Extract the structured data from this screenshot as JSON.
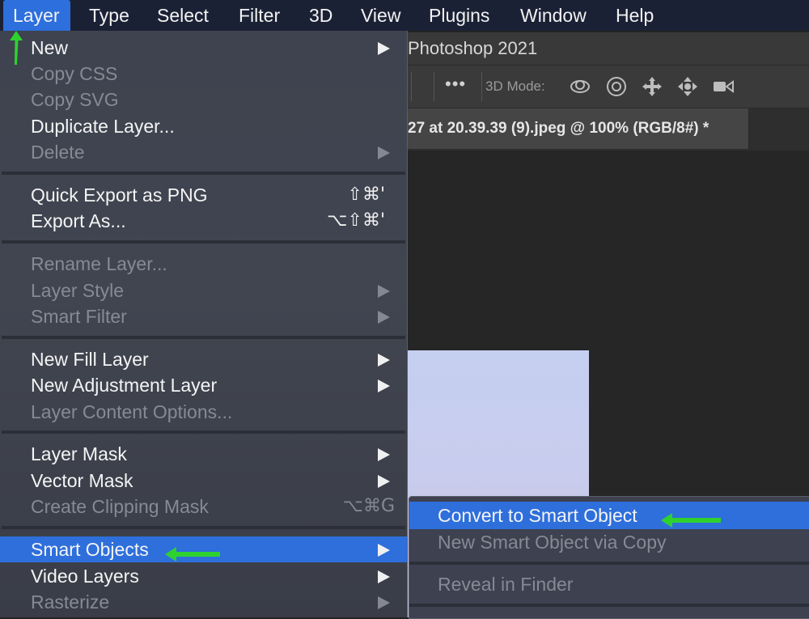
{
  "menubar": {
    "items": [
      "Layer",
      "Type",
      "Select",
      "Filter",
      "3D",
      "View",
      "Plugins",
      "Window",
      "Help"
    ],
    "active": "Layer"
  },
  "window": {
    "title": "Photoshop 2021",
    "options": {
      "more": "•••",
      "mode_label": "3D Mode:"
    },
    "document_tab": "27 at 20.39.39 (9).jpeg @ 100% (RGB/8#) *"
  },
  "menu": {
    "items": [
      {
        "label": "New",
        "submenu": true
      },
      {
        "label": "Copy CSS",
        "disabled": true
      },
      {
        "label": "Copy SVG",
        "disabled": true
      },
      {
        "label": "Duplicate Layer..."
      },
      {
        "label": "Delete",
        "disabled": true,
        "submenu": true
      },
      {
        "label": "Quick Export as PNG",
        "shortcut": "⇧⌘'"
      },
      {
        "label": "Export As...",
        "shortcut": "⌥⇧⌘'"
      },
      {
        "label": "Rename Layer...",
        "disabled": true
      },
      {
        "label": "Layer Style",
        "disabled": true,
        "submenu": true
      },
      {
        "label": "Smart Filter",
        "disabled": true,
        "submenu": true
      },
      {
        "label": "New Fill Layer",
        "submenu": true
      },
      {
        "label": "New Adjustment Layer",
        "submenu": true
      },
      {
        "label": "Layer Content Options...",
        "disabled": true
      },
      {
        "label": "Layer Mask",
        "submenu": true
      },
      {
        "label": "Vector Mask",
        "submenu": true
      },
      {
        "label": "Create Clipping Mask",
        "disabled": true,
        "shortcut": "⌥⌘G"
      },
      {
        "label": "Smart Objects",
        "submenu": true,
        "highlighted": true
      },
      {
        "label": "Video Layers",
        "submenu": true
      },
      {
        "label": "Rasterize",
        "disabled": true,
        "submenu": true
      }
    ]
  },
  "submenu": {
    "items": [
      {
        "label": "Convert to Smart Object",
        "highlighted": true
      },
      {
        "label": "New Smart Object via Copy",
        "disabled": true
      },
      {
        "label": "Reveal in Finder",
        "disabled": true
      }
    ]
  },
  "colors": {
    "menubar_bg": "#1b2135",
    "highlight": "#2e6fdc",
    "annotation_arrow": "#2fd12f"
  },
  "icons": [
    "3d-orbit-icon",
    "3d-roll-icon",
    "3d-pan-icon",
    "3d-slide-icon",
    "3d-camera-icon"
  ]
}
